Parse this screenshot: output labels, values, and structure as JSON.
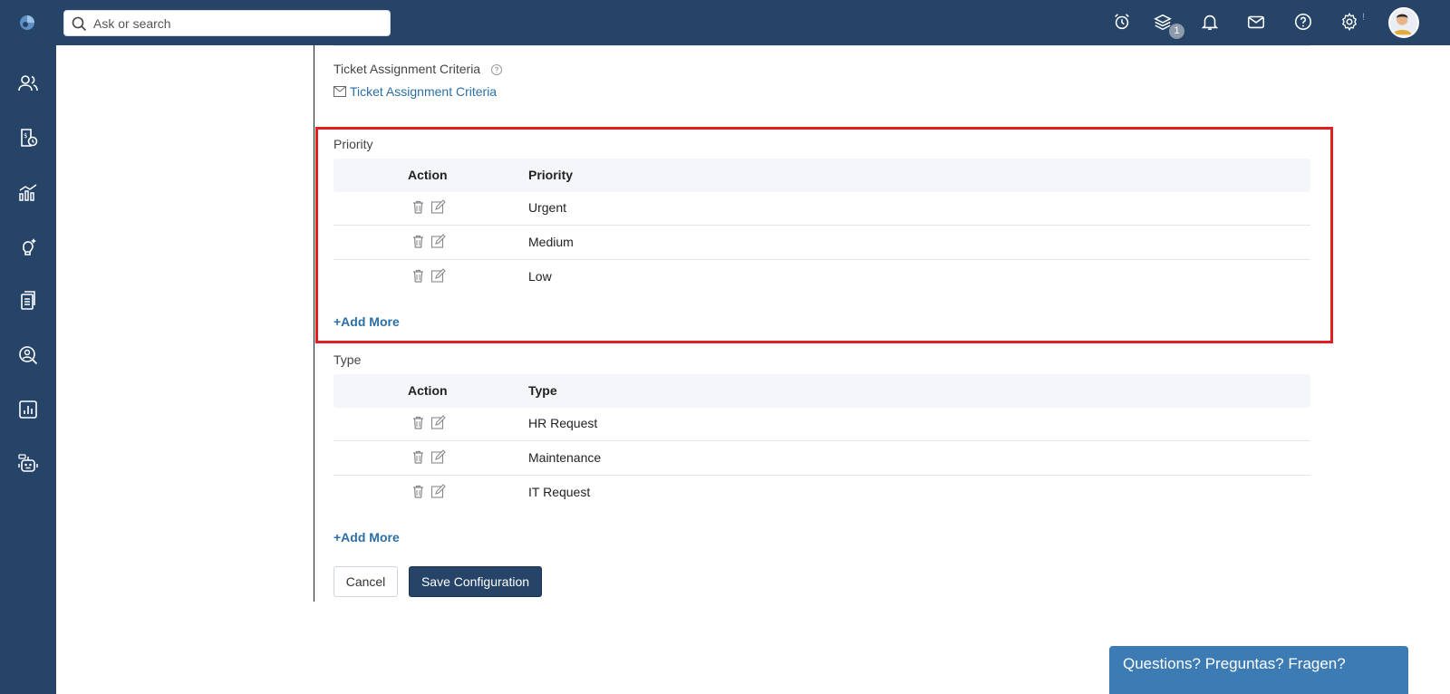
{
  "header": {
    "search_placeholder": "Ask or search",
    "layers_badge": "1",
    "settings_indicator": "!",
    "icons": [
      "alarm-clock-icon",
      "layers-icon",
      "bell-icon",
      "mail-icon",
      "help-icon",
      "gear-icon",
      "user-avatar"
    ]
  },
  "sidenav": {
    "icons": [
      "users-icon",
      "billing-icon",
      "analytics-icon",
      "ideas-icon",
      "documents-icon",
      "user-search-icon",
      "reports-icon",
      "bot-icon"
    ]
  },
  "assignment": {
    "label": "Ticket Assignment Criteria",
    "link": "Ticket Assignment Criteria"
  },
  "priority": {
    "section_title": "Priority",
    "col_action": "Action",
    "col_name": "Priority",
    "rows": [
      "Urgent",
      "Medium",
      "Low"
    ],
    "add_more": "+Add More"
  },
  "type": {
    "section_title": "Type",
    "col_action": "Action",
    "col_name": "Type",
    "rows": [
      "HR Request",
      "Maintenance",
      "IT Request"
    ],
    "add_more": "+Add More"
  },
  "buttons": {
    "cancel": "Cancel",
    "save": "Save Configuration"
  },
  "chat": {
    "label": "Questions? Preguntas? Fragen?"
  },
  "colors": {
    "nav_bg": "#264468",
    "link": "#2b6fa6",
    "highlight": "#e01e26",
    "chat_bg": "#3d7bb5"
  }
}
